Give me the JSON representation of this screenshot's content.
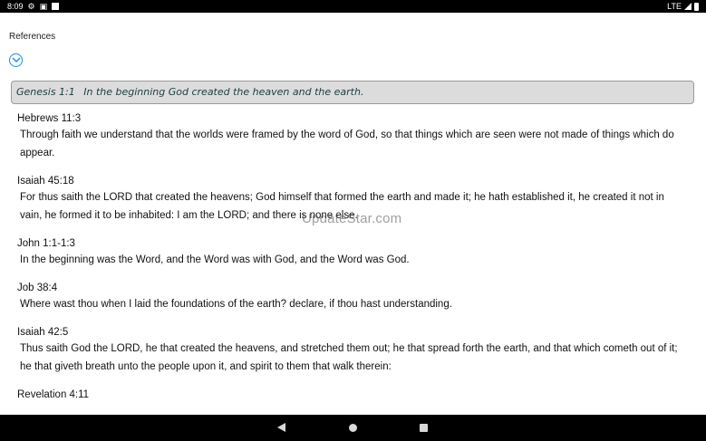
{
  "status_bar": {
    "time": "8:09",
    "network": "LTE",
    "icons": [
      "gear-icon",
      "a-icon",
      "sd-card-icon"
    ]
  },
  "header": {
    "title": "References",
    "expand_icon": "chevron-down-circle-icon"
  },
  "main_verse": {
    "reference": "Genesis 1:1",
    "text": "In the beginning God created the heaven and the earth."
  },
  "references": [
    {
      "title": "Hebrews 11:3",
      "text": "Through faith we understand that the worlds were framed by the word of God, so that things which are seen were not made of things which do appear."
    },
    {
      "title": "Isaiah 45:18",
      "text": "For thus saith the LORD that created the heavens; God himself that formed the earth and made it; he hath established it, he created it not in vain, he formed it to be inhabited: I am the LORD; and there is none else."
    },
    {
      "title": "John 1:1-1:3",
      "text": "In the beginning was the Word, and the Word was with God, and the Word was God."
    },
    {
      "title": "Job 38:4",
      "text": "Where wast thou when I laid the foundations of the earth? declare, if thou hast understanding."
    },
    {
      "title": "Isaiah 42:5",
      "text": "Thus saith God the LORD, he that created the heavens, and stretched them out; he that spread forth the earth, and that which cometh out of it; he that giveth breath unto the people upon it, and spirit to them that walk therein:"
    },
    {
      "title": "Revelation 4:11",
      "text": ""
    }
  ],
  "watermark": "UpdateStar.com",
  "nav_bar": {
    "icons": [
      "back-icon",
      "home-icon",
      "recents-icon"
    ]
  }
}
